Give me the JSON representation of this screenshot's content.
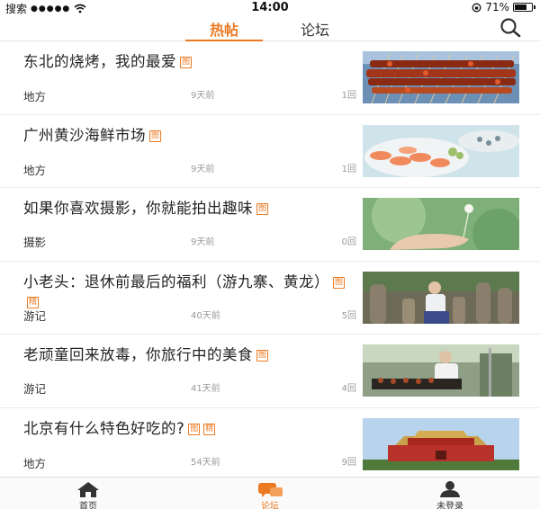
{
  "status_bar": {
    "carrier": "搜索",
    "signal": "●●●●●",
    "time": "14:00",
    "battery_percent": "71%",
    "battery_level": 0.71
  },
  "tabs": [
    {
      "label": "热帖",
      "active": true
    },
    {
      "label": "论坛",
      "active": false
    }
  ],
  "accent_color": "#ec7a22",
  "posts": [
    {
      "title": "东北的烧烤，我的最爱",
      "tags": [
        "图"
      ],
      "category": "地方",
      "time": "9天前",
      "replies": "1回",
      "thumb": "bbq-skewers-photo"
    },
    {
      "title": "广州黄沙海鲜市场",
      "tags": [
        "图"
      ],
      "category": "地方",
      "time": "9天前",
      "replies": "1回",
      "thumb": "seafood-plate-photo"
    },
    {
      "title": "如果你喜欢摄影，你就能拍出趣味",
      "tags": [
        "图"
      ],
      "category": "摄影",
      "time": "9天前",
      "replies": "0回",
      "thumb": "dandelion-hand-photo"
    },
    {
      "title": "小老头：退休前最后的福利（游九寨、黄龙）",
      "tags": [
        "图",
        "精"
      ],
      "category": "游记",
      "time": "40天前",
      "replies": "5回",
      "thumb": "statues-tourist-photo"
    },
    {
      "title": "老顽童回来放毒，你旅行中的美食",
      "tags": [
        "图"
      ],
      "category": "游记",
      "time": "41天前",
      "replies": "4回",
      "thumb": "street-grill-photo"
    },
    {
      "title": "北京有什么特色好吃的?",
      "tags": [
        "图",
        "精"
      ],
      "category": "地方",
      "time": "54天前",
      "replies": "9回",
      "thumb": "tiananmen-photo"
    }
  ],
  "bottom_nav": [
    {
      "label": "首页",
      "icon": "home-icon"
    },
    {
      "label": "论坛",
      "icon": "chat-icon"
    },
    {
      "label": "未登录",
      "icon": "user-icon"
    }
  ]
}
